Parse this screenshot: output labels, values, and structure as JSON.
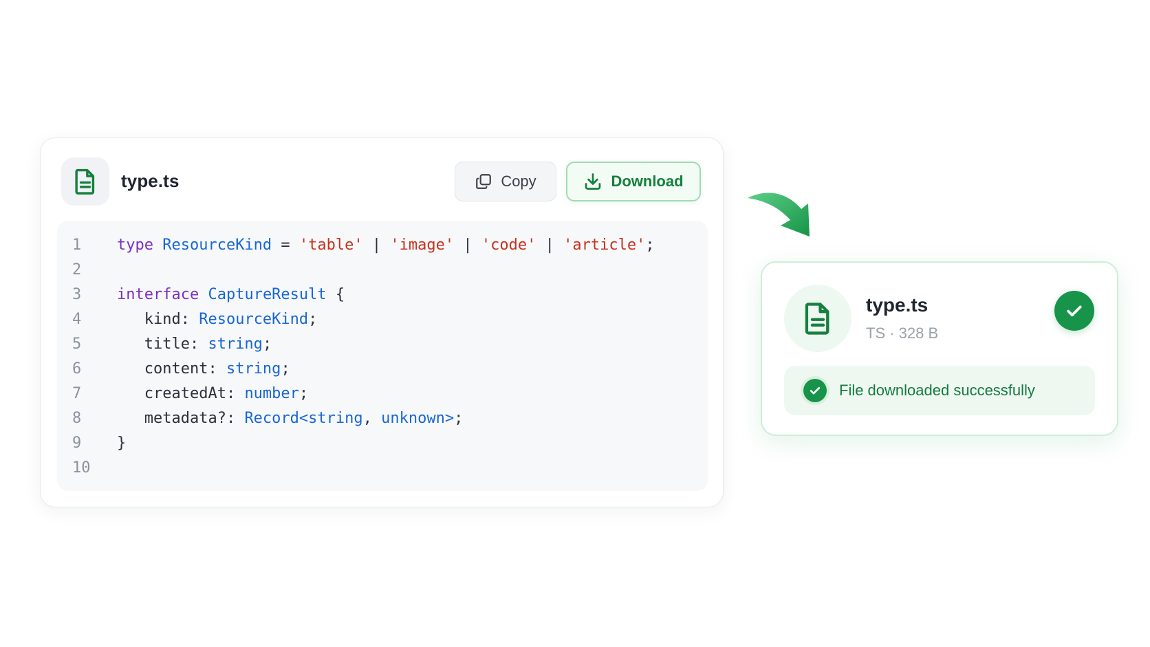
{
  "code_card": {
    "file_name": "type.ts",
    "file_icon": "file-icon",
    "copy_label": "Copy",
    "copy_icon": "copy-icon",
    "download_label": "Download",
    "download_icon": "download-icon"
  },
  "code": {
    "lines": [
      {
        "number": "1",
        "tokens": [
          {
            "t": "type",
            "c": "kw"
          },
          {
            "t": " ",
            "c": "pl"
          },
          {
            "t": "ResourceKind",
            "c": "ty"
          },
          {
            "t": " = ",
            "c": "pl"
          },
          {
            "t": "'table'",
            "c": "st"
          },
          {
            "t": " | ",
            "c": "pl"
          },
          {
            "t": "'image'",
            "c": "st"
          },
          {
            "t": " | ",
            "c": "pl"
          },
          {
            "t": "'code'",
            "c": "st"
          },
          {
            "t": " | ",
            "c": "pl"
          },
          {
            "t": "'article'",
            "c": "st"
          },
          {
            "t": ";",
            "c": "pl"
          }
        ]
      },
      {
        "number": "2",
        "tokens": []
      },
      {
        "number": "3",
        "tokens": [
          {
            "t": "interface",
            "c": "kw"
          },
          {
            "t": " ",
            "c": "pl"
          },
          {
            "t": "CaptureResult",
            "c": "ty"
          },
          {
            "t": " {",
            "c": "pl"
          }
        ]
      },
      {
        "number": "4",
        "tokens": [
          {
            "t": "   kind: ",
            "c": "pl"
          },
          {
            "t": "ResourceKind",
            "c": "ty"
          },
          {
            "t": ";",
            "c": "pl"
          }
        ]
      },
      {
        "number": "5",
        "tokens": [
          {
            "t": "   title: ",
            "c": "pl"
          },
          {
            "t": "string",
            "c": "ty"
          },
          {
            "t": ";",
            "c": "pl"
          }
        ]
      },
      {
        "number": "6",
        "tokens": [
          {
            "t": "   content: ",
            "c": "pl"
          },
          {
            "t": "string",
            "c": "ty"
          },
          {
            "t": ";",
            "c": "pl"
          }
        ]
      },
      {
        "number": "7",
        "tokens": [
          {
            "t": "   createdAt: ",
            "c": "pl"
          },
          {
            "t": "number",
            "c": "ty"
          },
          {
            "t": ";",
            "c": "pl"
          }
        ]
      },
      {
        "number": "8",
        "tokens": [
          {
            "t": "   metadata?: ",
            "c": "pl"
          },
          {
            "t": "Record<string",
            "c": "ty"
          },
          {
            "t": ", ",
            "c": "pl"
          },
          {
            "t": "unknown>",
            "c": "ty"
          },
          {
            "t": ";",
            "c": "pl"
          }
        ]
      },
      {
        "number": "9",
        "tokens": [
          {
            "t": "}",
            "c": "pl"
          }
        ]
      },
      {
        "number": "10",
        "tokens": []
      }
    ]
  },
  "result_card": {
    "file_name": "type.ts",
    "file_meta": "TS · 328 B",
    "file_icon": "file-icon",
    "status_icon": "check-circle-icon",
    "toast_message": "File downloaded successfully",
    "toast_icon": "check-circle-icon"
  },
  "colors": {
    "accent_green": "#17934a",
    "keyword": "#7b2fbe",
    "type": "#1766d6",
    "string": "#c8321d"
  }
}
